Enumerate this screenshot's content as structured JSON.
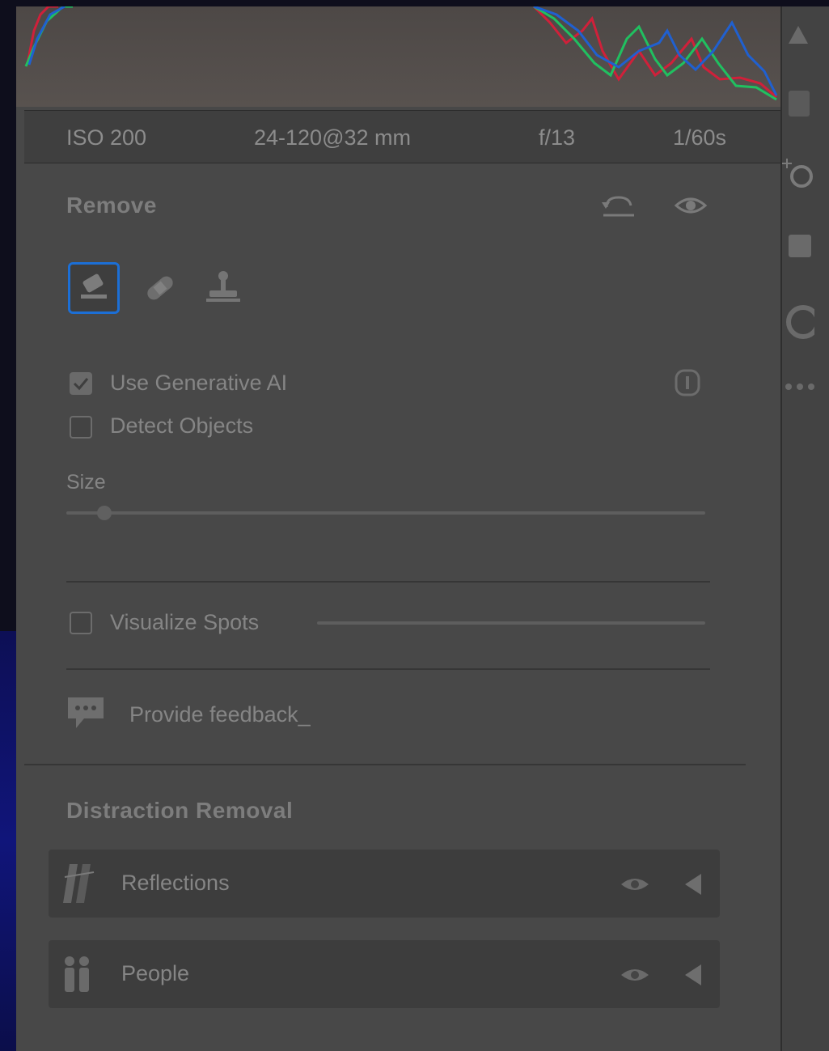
{
  "exif": {
    "iso": "ISO 200",
    "lens": "24-120@32 mm",
    "aperture": "f/13",
    "shutter": "1/60s"
  },
  "remove": {
    "title": "Remove",
    "tools": [
      "eraser-icon",
      "bandage-icon",
      "clone-stamp-icon"
    ],
    "use_generative_ai": {
      "label": "Use Generative AI",
      "checked": true
    },
    "detect_objects": {
      "label": "Detect Objects",
      "checked": false
    },
    "size_label": "Size",
    "size_value": 0.06,
    "visualize_spots": {
      "label": "Visualize Spots",
      "checked": false
    },
    "feedback_label": "Provide feedback_"
  },
  "distraction_removal": {
    "title": "Distraction Removal",
    "items": [
      {
        "label": "Reflections",
        "icon": "reflections-icon"
      },
      {
        "label": "People",
        "icon": "people-icon"
      }
    ]
  },
  "colors": {
    "active_tool_border": "#1c6fd6",
    "histogram_red": "#d0203a",
    "histogram_green": "#20c060",
    "histogram_blue": "#2060d0"
  }
}
